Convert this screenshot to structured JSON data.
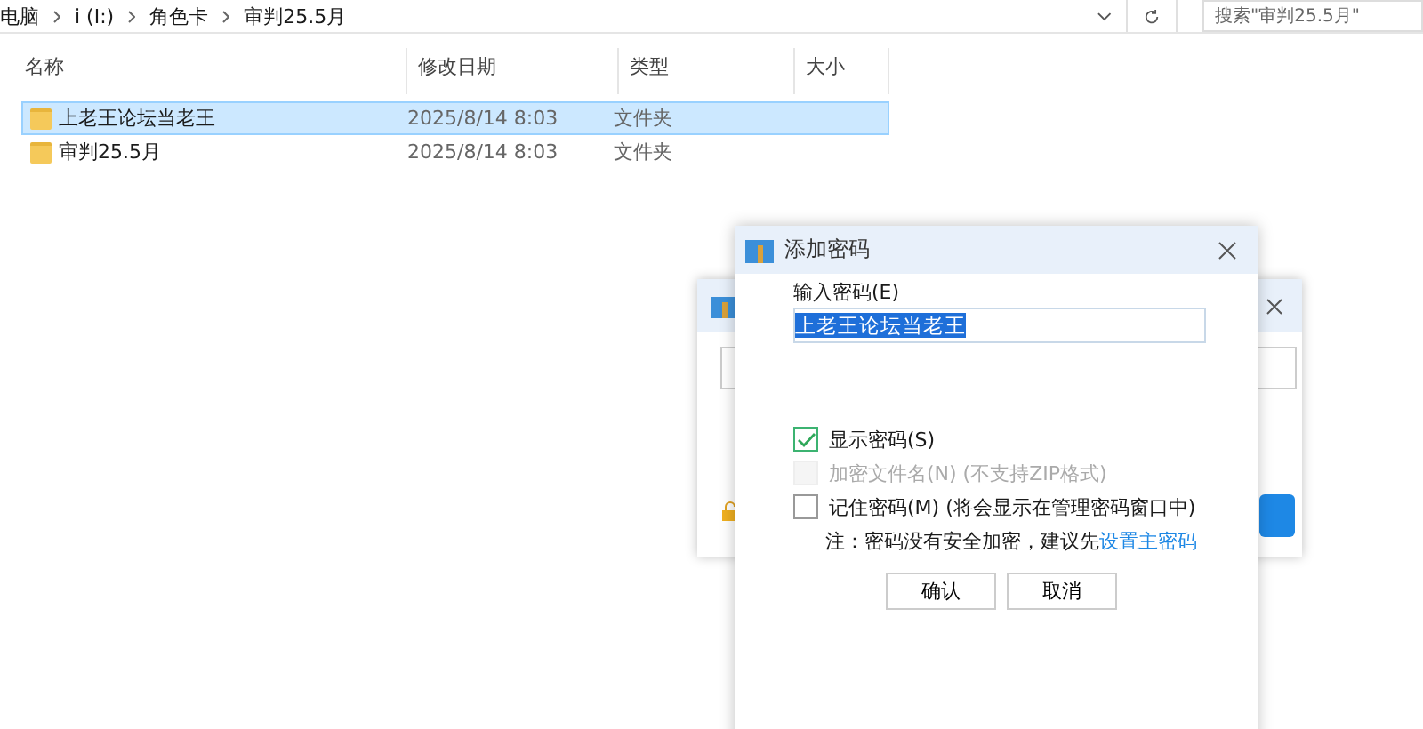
{
  "breadcrumb": [
    "电脑",
    "i (I:)",
    "角色卡",
    "审判25.5月"
  ],
  "search": {
    "placeholder": "搜索\"审判25.5月\""
  },
  "columns": [
    "名称",
    "修改日期",
    "类型",
    "大小"
  ],
  "rows": [
    {
      "name": "上老王论坛当老王",
      "date": "2025/8/14 8:03",
      "type": "文件夹",
      "selected": true
    },
    {
      "name": "审判25.5月",
      "date": "2025/8/14 8:03",
      "type": "文件夹",
      "selected": false
    }
  ],
  "dialog": {
    "title": "添加密码",
    "password_label": "输入密码(E)",
    "password_value": "上老王论坛当老王",
    "options": [
      {
        "label": "显示密码(S)",
        "checked": true,
        "disabled": false
      },
      {
        "label": "加密文件名(N) (不支持ZIP格式)",
        "checked": false,
        "disabled": true
      },
      {
        "label": "记住密码(M) (将会显示在管理密码窗口中)",
        "checked": false,
        "disabled": false
      }
    ],
    "note": "注：密码没有安全加密，建议先",
    "note_link": "设置主密码",
    "buttons": [
      "确认",
      "取消"
    ]
  }
}
